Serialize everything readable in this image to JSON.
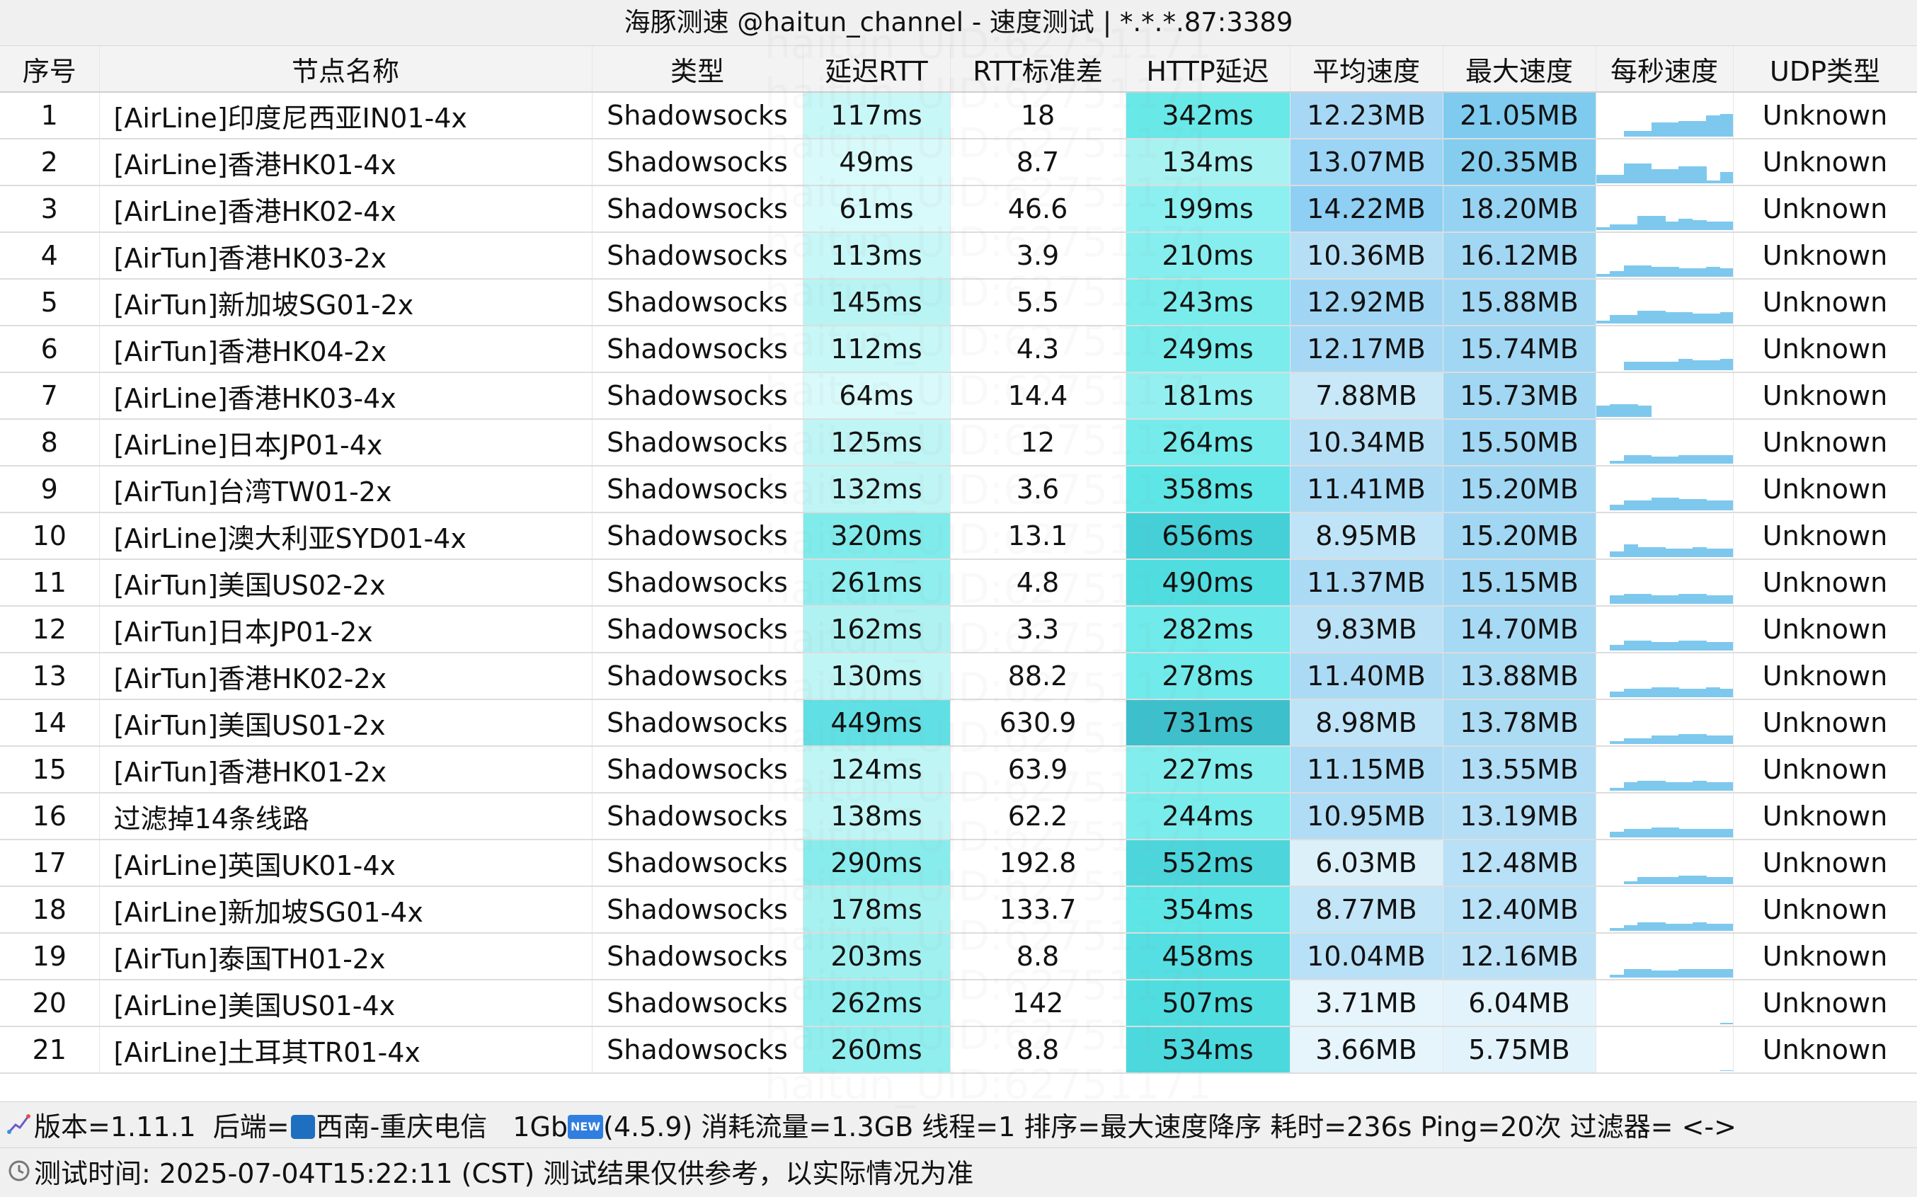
{
  "window": {
    "title": "海豚测速 @haitun_channel - 速度测试 | *.*.*.87:3389",
    "watermark": "haitun_UID:62751171"
  },
  "table": {
    "columns": [
      "序号",
      "节点名称",
      "类型",
      "延迟RTT",
      "RTT标准差",
      "HTTP延迟",
      "平均速度",
      "最大速度",
      "每秒速度",
      "UDP类型"
    ],
    "rows": [
      {
        "idx": "1",
        "name": "[AirLine]印度尼西亚IN01-4x",
        "type": "Shadowsocks",
        "rtt": "117ms",
        "std": "18",
        "http": "342ms",
        "avg": "12.23MB",
        "max": "21.05MB",
        "udp": "Unknown",
        "spark": [
          0,
          0,
          0.2,
          0.2,
          0.5,
          0.5,
          0.55,
          0.55,
          0.75,
          0.8
        ],
        "colors": {
          "rtt": "#c8f7f7",
          "http": "#69e8e8",
          "avg": "#a6d8f5",
          "max": "#7ecbef"
        }
      },
      {
        "idx": "2",
        "name": "[AirLine]香港HK01-4x",
        "type": "Shadowsocks",
        "rtt": "49ms",
        "std": "8.7",
        "http": "134ms",
        "avg": "13.07MB",
        "max": "20.35MB",
        "udp": "Unknown",
        "spark": [
          0.3,
          0.3,
          0.7,
          0.7,
          0.5,
          0.5,
          0.6,
          0.6,
          0.1,
          0.4
        ],
        "colors": {
          "rtt": "#d8fafa",
          "http": "#a9f2f2",
          "avg": "#9bd4f4",
          "max": "#84cdef"
        }
      },
      {
        "idx": "3",
        "name": "[AirLine]香港HK02-4x",
        "type": "Shadowsocks",
        "rtt": "61ms",
        "std": "46.6",
        "http": "199ms",
        "avg": "14.22MB",
        "max": "18.20MB",
        "udp": "Unknown",
        "spark": [
          0.1,
          0.2,
          0.2,
          0.5,
          0.5,
          0.3,
          0.4,
          0.35,
          0.3,
          0.3
        ],
        "colors": {
          "rtt": "#d8fafa",
          "http": "#8cf0f0",
          "avg": "#8ecff3",
          "max": "#96d3f2"
        }
      },
      {
        "idx": "4",
        "name": "[AirTun]香港HK03-2x",
        "type": "Shadowsocks",
        "rtt": "113ms",
        "std": "3.9",
        "http": "210ms",
        "avg": "10.36MB",
        "max": "16.12MB",
        "udp": "Unknown",
        "spark": [
          0.1,
          0.2,
          0.4,
          0.4,
          0.35,
          0.35,
          0.3,
          0.3,
          0.35,
          0.3
        ],
        "colors": {
          "rtt": "#c8f7f7",
          "http": "#86eeee",
          "avg": "#b6dff6",
          "max": "#a1d7f3"
        }
      },
      {
        "idx": "5",
        "name": "[AirTun]新加坡SG01-2x",
        "type": "Shadowsocks",
        "rtt": "145ms",
        "std": "5.5",
        "http": "243ms",
        "avg": "12.92MB",
        "max": "15.88MB",
        "udp": "Unknown",
        "spark": [
          0.1,
          0.3,
          0.3,
          0.45,
          0.45,
          0.4,
          0.4,
          0.35,
          0.35,
          0.4
        ],
        "colors": {
          "rtt": "#b8f4f4",
          "http": "#7aecec",
          "avg": "#a0d6f4",
          "max": "#a1d7f3"
        }
      },
      {
        "idx": "6",
        "name": "[AirTun]香港HK04-2x",
        "type": "Shadowsocks",
        "rtt": "112ms",
        "std": "4.3",
        "http": "249ms",
        "avg": "12.17MB",
        "max": "15.74MB",
        "udp": "Unknown",
        "spark": [
          0,
          0,
          0.3,
          0.3,
          0.3,
          0.3,
          0.4,
          0.35,
          0.35,
          0.4
        ],
        "colors": {
          "rtt": "#c8f7f7",
          "http": "#7aecec",
          "avg": "#a6d8f5",
          "max": "#a1d7f3"
        }
      },
      {
        "idx": "7",
        "name": "[AirLine]香港HK03-4x",
        "type": "Shadowsocks",
        "rtt": "64ms",
        "std": "14.4",
        "http": "181ms",
        "avg": "7.88MB",
        "max": "15.73MB",
        "udp": "Unknown",
        "spark": [
          0.4,
          0.45,
          0.45,
          0.4,
          0,
          0,
          0,
          0,
          0,
          0
        ],
        "colors": {
          "rtt": "#d8fafa",
          "http": "#94f0f0",
          "avg": "#c8e8f8",
          "max": "#a1d7f3"
        }
      },
      {
        "idx": "8",
        "name": "[AirLine]日本JP01-4x",
        "type": "Shadowsocks",
        "rtt": "125ms",
        "std": "12",
        "http": "264ms",
        "avg": "10.34MB",
        "max": "15.50MB",
        "udp": "Unknown",
        "spark": [
          0,
          0.1,
          0.3,
          0.3,
          0.25,
          0.25,
          0.3,
          0.3,
          0.3,
          0.3
        ],
        "colors": {
          "rtt": "#c0f5f5",
          "http": "#75ebeb",
          "avg": "#b6dff6",
          "max": "#a1d7f3"
        }
      },
      {
        "idx": "9",
        "name": "[AirTun]台湾TW01-2x",
        "type": "Shadowsocks",
        "rtt": "132ms",
        "std": "3.6",
        "http": "358ms",
        "avg": "11.41MB",
        "max": "15.20MB",
        "udp": "Unknown",
        "spark": [
          0,
          0.2,
          0.35,
          0.35,
          0.45,
          0.45,
          0.4,
          0.4,
          0.35,
          0.35
        ],
        "colors": {
          "rtt": "#c0f5f5",
          "http": "#5ee6e6",
          "avg": "#abdaf5",
          "max": "#a1d7f3"
        }
      },
      {
        "idx": "10",
        "name": "[AirLine]澳大利亚SYD01-4x",
        "type": "Shadowsocks",
        "rtt": "320ms",
        "std": "13.1",
        "http": "656ms",
        "avg": "8.95MB",
        "max": "15.20MB",
        "udp": "Unknown",
        "spark": [
          0,
          0.2,
          0.45,
          0.35,
          0.35,
          0.3,
          0.3,
          0.35,
          0.3,
          0.3
        ],
        "colors": {
          "rtt": "#80ebeb",
          "http": "#45d0d8",
          "avg": "#c0e4f7",
          "max": "#a1d7f3"
        }
      },
      {
        "idx": "11",
        "name": "[AirTun]美国US02-2x",
        "type": "Shadowsocks",
        "rtt": "261ms",
        "std": "4.8",
        "http": "490ms",
        "avg": "11.37MB",
        "max": "15.15MB",
        "udp": "Unknown",
        "spark": [
          0,
          0.3,
          0.35,
          0.35,
          0.3,
          0.3,
          0.35,
          0.35,
          0.3,
          0.3
        ],
        "colors": {
          "rtt": "#90eeee",
          "http": "#50dde0",
          "avg": "#abdaf5",
          "max": "#a1d7f3"
        }
      },
      {
        "idx": "12",
        "name": "[AirTun]日本JP01-2x",
        "type": "Shadowsocks",
        "rtt": "162ms",
        "std": "3.3",
        "http": "282ms",
        "avg": "9.83MB",
        "max": "14.70MB",
        "udp": "Unknown",
        "spark": [
          0,
          0.2,
          0.35,
          0.35,
          0.3,
          0.3,
          0.35,
          0.35,
          0.3,
          0.3
        ],
        "colors": {
          "rtt": "#b0f2f2",
          "http": "#70eaea",
          "avg": "#baE1f6",
          "max": "#a6d9f4"
        }
      },
      {
        "idx": "13",
        "name": "[AirTun]香港HK02-2x",
        "type": "Shadowsocks",
        "rtt": "130ms",
        "std": "88.2",
        "http": "278ms",
        "avg": "11.40MB",
        "max": "13.88MB",
        "udp": "Unknown",
        "spark": [
          0,
          0.2,
          0.3,
          0.3,
          0.35,
          0.35,
          0.3,
          0.3,
          0.35,
          0.3
        ],
        "colors": {
          "rtt": "#c0f5f5",
          "http": "#70eaea",
          "avg": "#abdaf5",
          "max": "#acdbf4"
        }
      },
      {
        "idx": "14",
        "name": "[AirTun]美国US01-2x",
        "type": "Shadowsocks",
        "rtt": "449ms",
        "std": "630.9",
        "http": "731ms",
        "avg": "8.98MB",
        "max": "13.78MB",
        "udp": "Unknown",
        "spark": [
          0,
          0.1,
          0.2,
          0.2,
          0.3,
          0.3,
          0.35,
          0.35,
          0.3,
          0.3
        ],
        "colors": {
          "rtt": "#60e0e4",
          "http": "#3ec0cc",
          "avg": "#c0e4f7",
          "max": "#acdbf4"
        }
      },
      {
        "idx": "15",
        "name": "[AirTun]香港HK01-2x",
        "type": "Shadowsocks",
        "rtt": "124ms",
        "std": "63.9",
        "http": "227ms",
        "avg": "11.15MB",
        "max": "13.55MB",
        "udp": "Unknown",
        "spark": [
          0,
          0.1,
          0.3,
          0.35,
          0.35,
          0.3,
          0.3,
          0.35,
          0.3,
          0.3
        ],
        "colors": {
          "rtt": "#c0f5f5",
          "http": "#82eded",
          "avg": "#addbf5",
          "max": "#b0ddf5"
        }
      },
      {
        "idx": "16",
        "name": "过滤掉14条线路",
        "type": "Shadowsocks",
        "rtt": "138ms",
        "std": "62.2",
        "http": "244ms",
        "avg": "10.95MB",
        "max": "13.19MB",
        "udp": "Unknown",
        "spark": [
          0,
          0.2,
          0.3,
          0.3,
          0.35,
          0.35,
          0.3,
          0.3,
          0.3,
          0.3
        ],
        "colors": {
          "rtt": "#c0f5f5",
          "http": "#7aecec",
          "avg": "#b0dcf5",
          "max": "#b3def5"
        }
      },
      {
        "idx": "17",
        "name": "[AirLine]英国UK01-4x",
        "type": "Shadowsocks",
        "rtt": "290ms",
        "std": "192.8",
        "http": "552ms",
        "avg": "6.03MB",
        "max": "12.48MB",
        "udp": "Unknown",
        "spark": [
          0,
          0,
          0.1,
          0.25,
          0.25,
          0.25,
          0.3,
          0.3,
          0.25,
          0.25
        ],
        "colors": {
          "rtt": "#88ecec",
          "http": "#4cd6dc",
          "avg": "#dcf0fa",
          "max": "#b8e0f6"
        }
      },
      {
        "idx": "18",
        "name": "[AirLine]新加坡SG01-4x",
        "type": "Shadowsocks",
        "rtt": "178ms",
        "std": "133.7",
        "http": "354ms",
        "avg": "8.77MB",
        "max": "12.40MB",
        "udp": "Unknown",
        "spark": [
          0,
          0.1,
          0.2,
          0.3,
          0.3,
          0.25,
          0.25,
          0.3,
          0.25,
          0.25
        ],
        "colors": {
          "rtt": "#a8f1f1",
          "http": "#5ee6e6",
          "avg": "#c2e5f7",
          "max": "#b8e0f6"
        }
      },
      {
        "idx": "19",
        "name": "[AirTun]泰国TH01-2x",
        "type": "Shadowsocks",
        "rtt": "203ms",
        "std": "8.8",
        "http": "458ms",
        "avg": "10.04MB",
        "max": "12.16MB",
        "udp": "Unknown",
        "spark": [
          0,
          0.1,
          0.3,
          0.3,
          0.25,
          0.25,
          0.3,
          0.3,
          0.3,
          0.3
        ],
        "colors": {
          "rtt": "#a0f0f0",
          "http": "#55dfe2",
          "avg": "#b8e0f6",
          "max": "#bbe1f6"
        }
      },
      {
        "idx": "20",
        "name": "[AirLine]美国US01-4x",
        "type": "Shadowsocks",
        "rtt": "262ms",
        "std": "142",
        "http": "507ms",
        "avg": "3.71MB",
        "max": "6.04MB",
        "udp": "Unknown",
        "spark": [
          0,
          0,
          0,
          0,
          0,
          0,
          0,
          0,
          0,
          0.05
        ],
        "colors": {
          "rtt": "#90eeee",
          "http": "#50dde0",
          "avg": "#e6f5fc",
          "max": "#e3f3fb"
        }
      },
      {
        "idx": "21",
        "name": "[AirLine]土耳其TR01-4x",
        "type": "Shadowsocks",
        "rtt": "260ms",
        "std": "8.8",
        "http": "534ms",
        "avg": "3.66MB",
        "max": "5.75MB",
        "udp": "Unknown",
        "spark": [
          0,
          0,
          0,
          0,
          0,
          0,
          0,
          0,
          0,
          0.03
        ],
        "colors": {
          "rtt": "#90eeee",
          "http": "#4cd9de",
          "avg": "#e6f5fc",
          "max": "#e3f3fb"
        }
      }
    ]
  },
  "footer": {
    "line1": {
      "version": "版本=1.11.1",
      "backend_prefix": "后端=",
      "backend_name": "西南-重庆电信",
      "speed_prefix": "1Gb",
      "new_badge": "NEW",
      "speed_suffix": "(4.5.9) 消耗流量=1.3GB  线程=1  排序=最大速度降序  耗时=236s  Ping=20次  过滤器= <->"
    },
    "line2": "测试时间: 2025-07-04T15:22:11 (CST)  测试结果仅供参考，以实际情况为准",
    "icons": [
      "graph-icon",
      "clock-icon"
    ]
  },
  "colors": {
    "spark_fill": "#7ec8ee",
    "header_bg": "#f3f3f3",
    "footer_bg": "#f0f0f0"
  }
}
